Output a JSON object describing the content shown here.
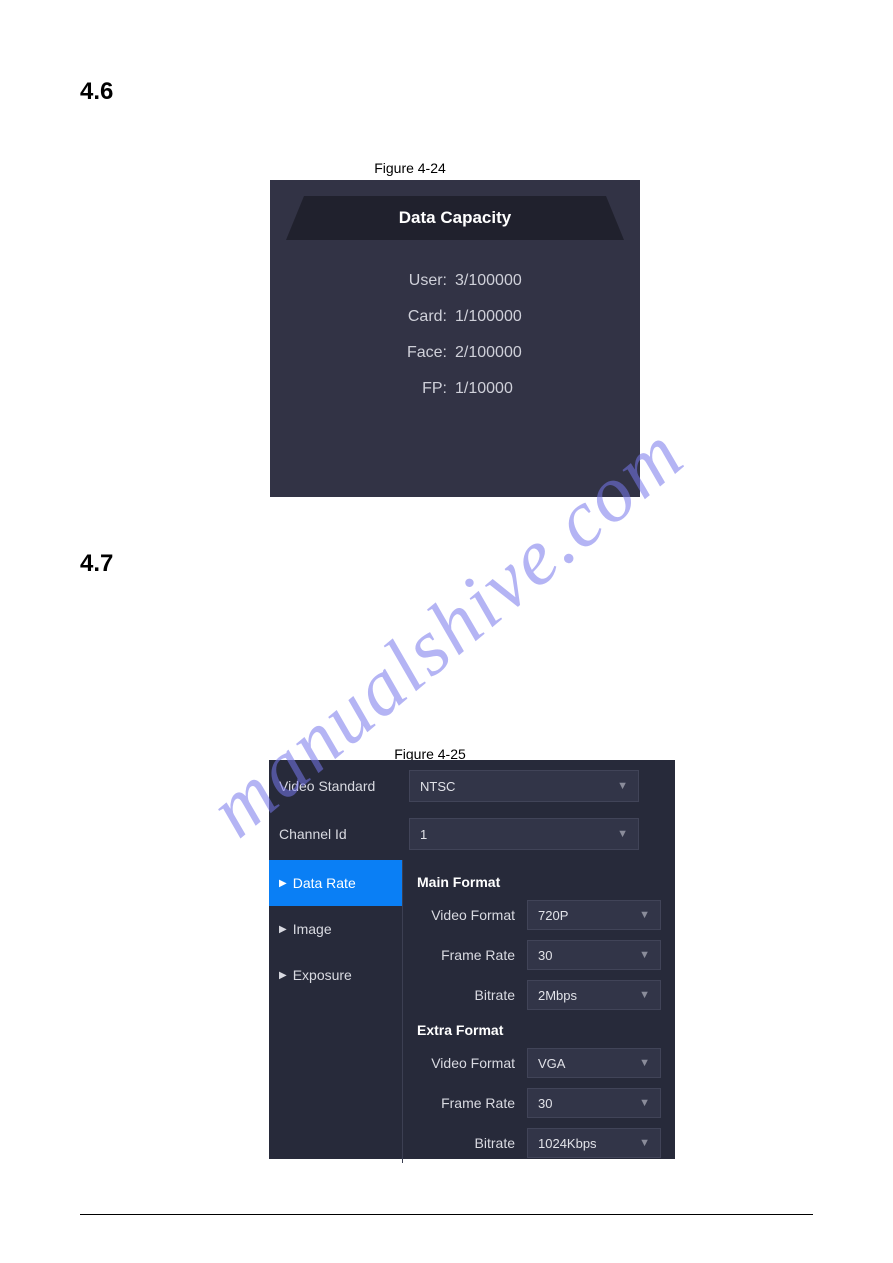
{
  "watermark": "manualshive.com",
  "sections": {
    "sec46": "4.6",
    "sec47": "4.7"
  },
  "figures": {
    "fig424_caption": "Figure 4-24",
    "fig425_caption": "Figure 4-25"
  },
  "data_capacity": {
    "title": "Data Capacity",
    "rows": [
      {
        "label": "User:",
        "value": "3/100000"
      },
      {
        "label": "Card:",
        "value": "1/100000"
      },
      {
        "label": "Face:",
        "value": "2/100000"
      },
      {
        "label": "FP:",
        "value": "1/10000"
      }
    ]
  },
  "video_settings": {
    "top": {
      "video_standard": {
        "label": "Video Standard",
        "value": "NTSC"
      },
      "channel_id": {
        "label": "Channel Id",
        "value": "1"
      }
    },
    "side": {
      "data_rate": "Data Rate",
      "image": "Image",
      "exposure": "Exposure"
    },
    "main_format": {
      "title": "Main Format",
      "video_format": {
        "label": "Video Format",
        "value": "720P"
      },
      "frame_rate": {
        "label": "Frame Rate",
        "value": "30"
      },
      "bitrate": {
        "label": "Bitrate",
        "value": "2Mbps"
      }
    },
    "extra_format": {
      "title": "Extra Format",
      "video_format": {
        "label": "Video Format",
        "value": "VGA"
      },
      "frame_rate": {
        "label": "Frame Rate",
        "value": "30"
      },
      "bitrate": {
        "label": "Bitrate",
        "value": "1024Kbps"
      }
    }
  }
}
